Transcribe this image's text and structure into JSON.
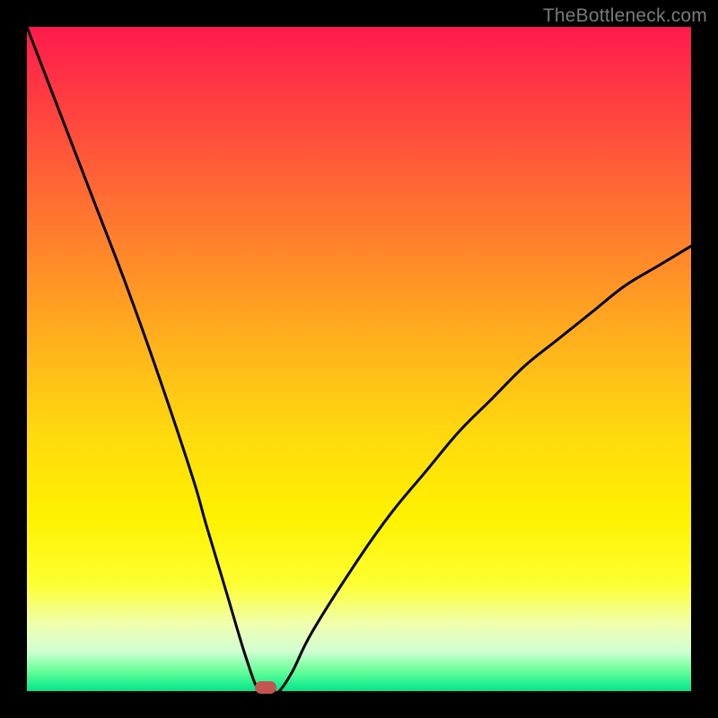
{
  "watermark": "TheBottleneck.com",
  "chart_data": {
    "type": "line",
    "title": "",
    "xlabel": "",
    "ylabel": "",
    "xlim": [
      0,
      100
    ],
    "ylim": [
      0,
      100
    ],
    "grid": false,
    "legend": false,
    "series": [
      {
        "name": "bottleneck-curve",
        "x": [
          0,
          5,
          10,
          15,
          20,
          25,
          27,
          30,
          33,
          35,
          37,
          38,
          40,
          43,
          50,
          55,
          60,
          65,
          70,
          75,
          80,
          85,
          90,
          95,
          100
        ],
        "values": [
          100,
          87,
          74,
          61,
          47,
          32,
          25,
          15,
          5,
          0,
          0,
          0,
          3,
          9,
          20,
          27,
          33,
          39,
          44,
          49,
          53,
          57,
          61,
          64,
          67
        ]
      }
    ],
    "marker": {
      "x": 36,
      "y": 0.5,
      "label": "optimal-point"
    },
    "gradient_stops": [
      {
        "pos": 0,
        "color": "#ff1a4d"
      },
      {
        "pos": 50,
        "color": "#ffdb0d"
      },
      {
        "pos": 100,
        "color": "#00e68a"
      }
    ]
  }
}
